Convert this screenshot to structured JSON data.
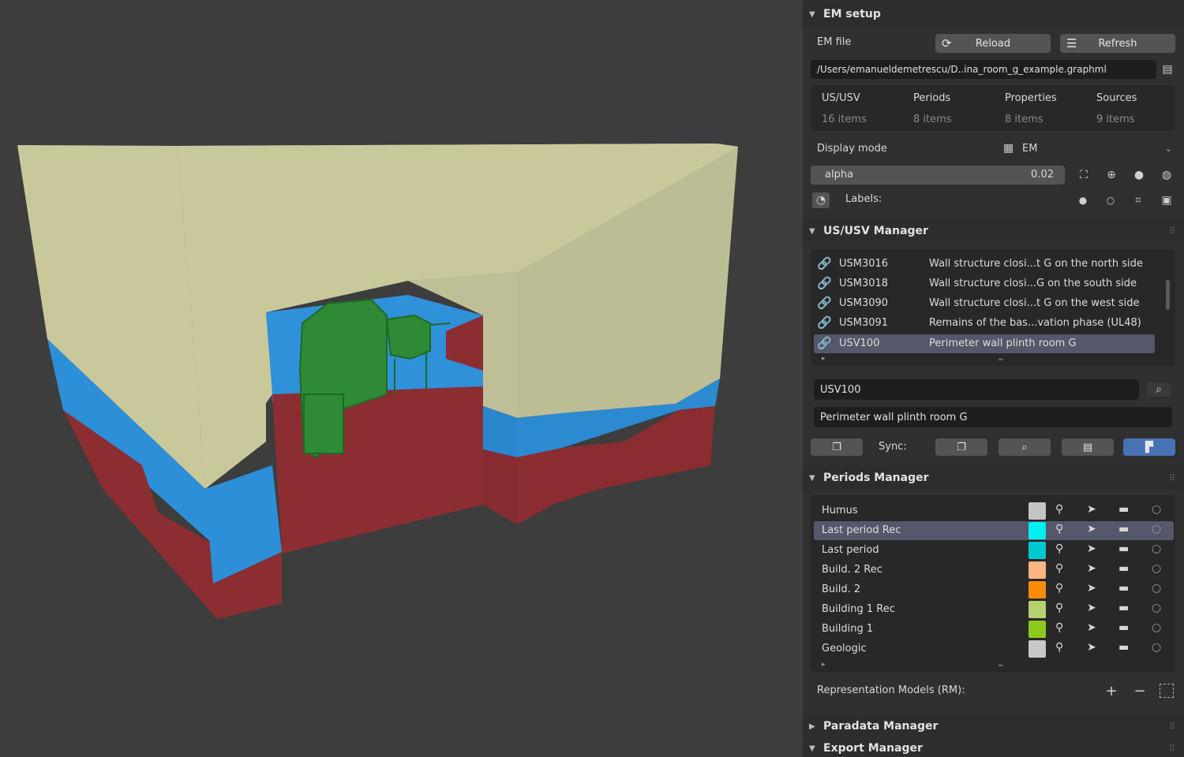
{
  "em_setup": {
    "title": "EM setup",
    "em_file_label": "EM file",
    "reload_label": "Reload",
    "refresh_label": "Refresh",
    "file_path": "/Users/emanueldemetrescu/D..ina_room_g_example.graphml",
    "stats": [
      {
        "label": "US/USV",
        "value": "16 items"
      },
      {
        "label": "Periods",
        "value": "8 items"
      },
      {
        "label": "Properties",
        "value": "8 items"
      },
      {
        "label": "Sources",
        "value": "9 items"
      }
    ],
    "display_mode_label": "Display mode",
    "display_mode_value": "EM",
    "alpha_label": "alpha",
    "alpha_value": "0.02",
    "labels_label": "Labels:"
  },
  "us_manager": {
    "title": "US/USV Manager",
    "rows": [
      {
        "code": "USM3016",
        "desc": "Wall structure closi...t G on the north side"
      },
      {
        "code": "USM3018",
        "desc": "Wall structure closi...G on the south side"
      },
      {
        "code": "USM3090",
        "desc": "Wall structure closi...t G on the west side"
      },
      {
        "code": "USM3091",
        "desc": "Remains of the bas...vation phase (UL48)"
      },
      {
        "code": "USV100",
        "desc": "Perimeter wall plinth room G"
      }
    ],
    "selected_index": 4,
    "name_value": "USV100",
    "description_value": "Perimeter wall plinth room G",
    "sync_label": "Sync:"
  },
  "periods_manager": {
    "title": "Periods Manager",
    "rows": [
      {
        "name": "Humus",
        "color": "#c4c4c4"
      },
      {
        "name": "Last period Rec",
        "color": "#00f0f0"
      },
      {
        "name": "Last period",
        "color": "#00c8d2"
      },
      {
        "name": "Build. 2  Rec",
        "color": "#fcb482"
      },
      {
        "name": "Build. 2",
        "color": "#fa8c0a"
      },
      {
        "name": "Building 1 Rec",
        "color": "#b4d26e"
      },
      {
        "name": "Building 1",
        "color": "#8cc81e"
      },
      {
        "name": "Geologic",
        "color": "#c8c8c8"
      }
    ],
    "selected_index": 1,
    "rm_label": "Representation Models (RM):"
  },
  "paradata_manager": {
    "title": "Paradata Manager"
  },
  "export_manager": {
    "title": "Export Manager"
  },
  "colors": {
    "panel_bg": "#303030",
    "viewport_bg": "#3d3d3d",
    "selection": "#54586a",
    "active_button": "#4772b3",
    "wall_top": "#c8c89b",
    "wall_blue": "#2d8fd7",
    "wall_red": "#8c2d32",
    "object_green": "#2f8a35"
  },
  "icons": [
    "reload-icon",
    "list-icon",
    "folder-icon",
    "link-icon",
    "eyedropper-icon",
    "select-icon",
    "display-icon",
    "circle-icon",
    "plus-icon",
    "minus-icon"
  ]
}
